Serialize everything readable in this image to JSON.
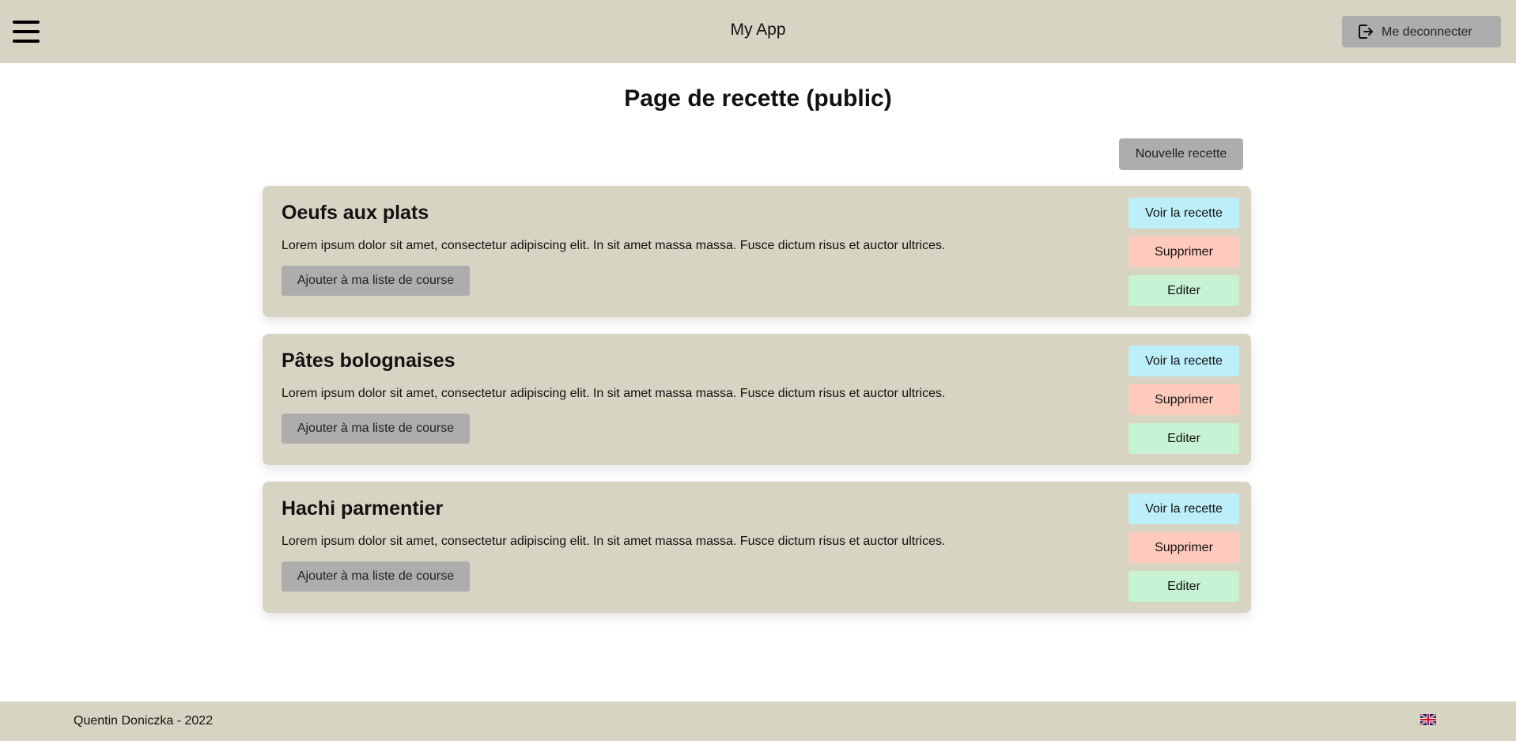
{
  "header": {
    "app_title": "My App",
    "logout_label": "Me deconnecter",
    "menu_icon": "hamburger-menu-icon",
    "logout_icon": "logout-icon"
  },
  "main": {
    "page_title": "Page de recette (public)",
    "new_recipe_label": "Nouvelle recette",
    "recipes": [
      {
        "title": "Oeufs aux plats",
        "description": "Lorem ipsum dolor sit amet, consectetur adipiscing elit. In sit amet massa massa. Fusce dictum risus et auctor ultrices.",
        "add_label": "Ajouter à ma liste de course",
        "view_label": "Voir la recette",
        "delete_label": "Supprimer",
        "edit_label": "Editer"
      },
      {
        "title": "Pâtes bolognaises",
        "description": "Lorem ipsum dolor sit amet, consectetur adipiscing elit. In sit amet massa massa. Fusce dictum risus et auctor ultrices.",
        "add_label": "Ajouter à ma liste de course",
        "view_label": "Voir la recette",
        "delete_label": "Supprimer",
        "edit_label": "Editer"
      },
      {
        "title": "Hachi parmentier",
        "description": "Lorem ipsum dolor sit amet, consectetur adipiscing elit. In sit amet massa massa. Fusce dictum risus et auctor ultrices.",
        "add_label": "Ajouter à ma liste de course",
        "view_label": "Voir la recette",
        "delete_label": "Supprimer",
        "edit_label": "Editer"
      }
    ]
  },
  "footer": {
    "credit": "Quentin Doniczka - 2022",
    "language_icon": "uk-flag-icon"
  },
  "colors": {
    "header_bg": "#d7d4c3",
    "card_bg": "#d7d4c3",
    "neutral_button": "#adadad",
    "view_button": "#bdeff9",
    "delete_button": "#fecabc",
    "edit_button": "#c8f2d4"
  }
}
